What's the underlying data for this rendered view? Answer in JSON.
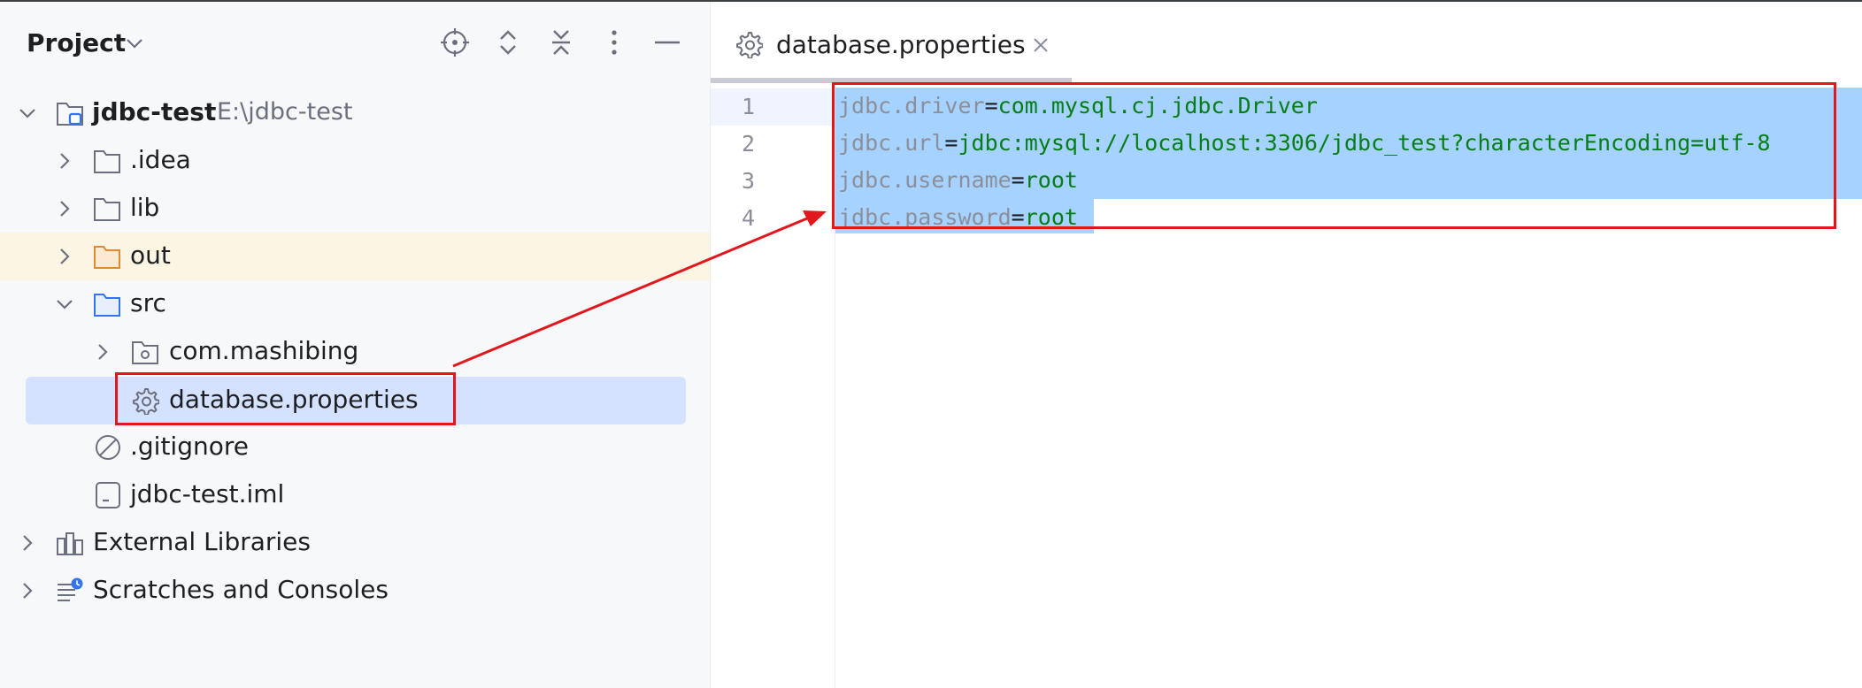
{
  "project_panel": {
    "title": "Project",
    "toolbar_icons": [
      "locate-icon",
      "expand-all-icon",
      "collapse-all-icon",
      "more-options-icon",
      "hide-icon"
    ],
    "tree": [
      {
        "label": "jdbc-test",
        "path": "E:\\jdbc-test",
        "expanded": true,
        "icon": "module-folder-icon"
      },
      {
        "label": ".idea",
        "expanded": false,
        "icon": "folder-icon"
      },
      {
        "label": "lib",
        "expanded": false,
        "icon": "folder-icon"
      },
      {
        "label": "out",
        "expanded": false,
        "icon": "excluded-folder-icon"
      },
      {
        "label": "src",
        "expanded": true,
        "icon": "source-folder-icon"
      },
      {
        "label": "com.mashibing",
        "expanded": false,
        "icon": "package-icon"
      },
      {
        "label": "database.properties",
        "selected": true,
        "icon": "properties-file-icon"
      },
      {
        "label": ".gitignore",
        "icon": "ignore-file-icon"
      },
      {
        "label": "jdbc-test.iml",
        "icon": "module-file-icon"
      },
      {
        "label": "External Libraries",
        "expanded": false,
        "icon": "libraries-icon"
      },
      {
        "label": "Scratches and Consoles",
        "expanded": false,
        "icon": "scratches-icon"
      }
    ]
  },
  "editor": {
    "tab": {
      "label": "database.properties",
      "icon": "properties-file-icon"
    },
    "lines": [
      {
        "number": "1",
        "key": "jdbc.driver",
        "eq": "=",
        "value": "com.mysql.cj.jdbc.Driver"
      },
      {
        "number": "2",
        "key": "jdbc.url",
        "eq": "=",
        "value": "jdbc:mysql://localhost:3306/jdbc_test?characterEncoding=utf-8"
      },
      {
        "number": "3",
        "key": "jdbc.username",
        "eq": "=",
        "value": "root"
      },
      {
        "number": "4",
        "key": "jdbc.password",
        "eq": "=",
        "value": "root"
      }
    ]
  },
  "colors": {
    "selection": "#a6d2ff",
    "key_gray": "#8c8f99",
    "value_green": "#067d17",
    "annotation_red": "#e2171d",
    "tree_selected": "#d4e2ff",
    "excluded_highlight": "#fdf5e3"
  }
}
